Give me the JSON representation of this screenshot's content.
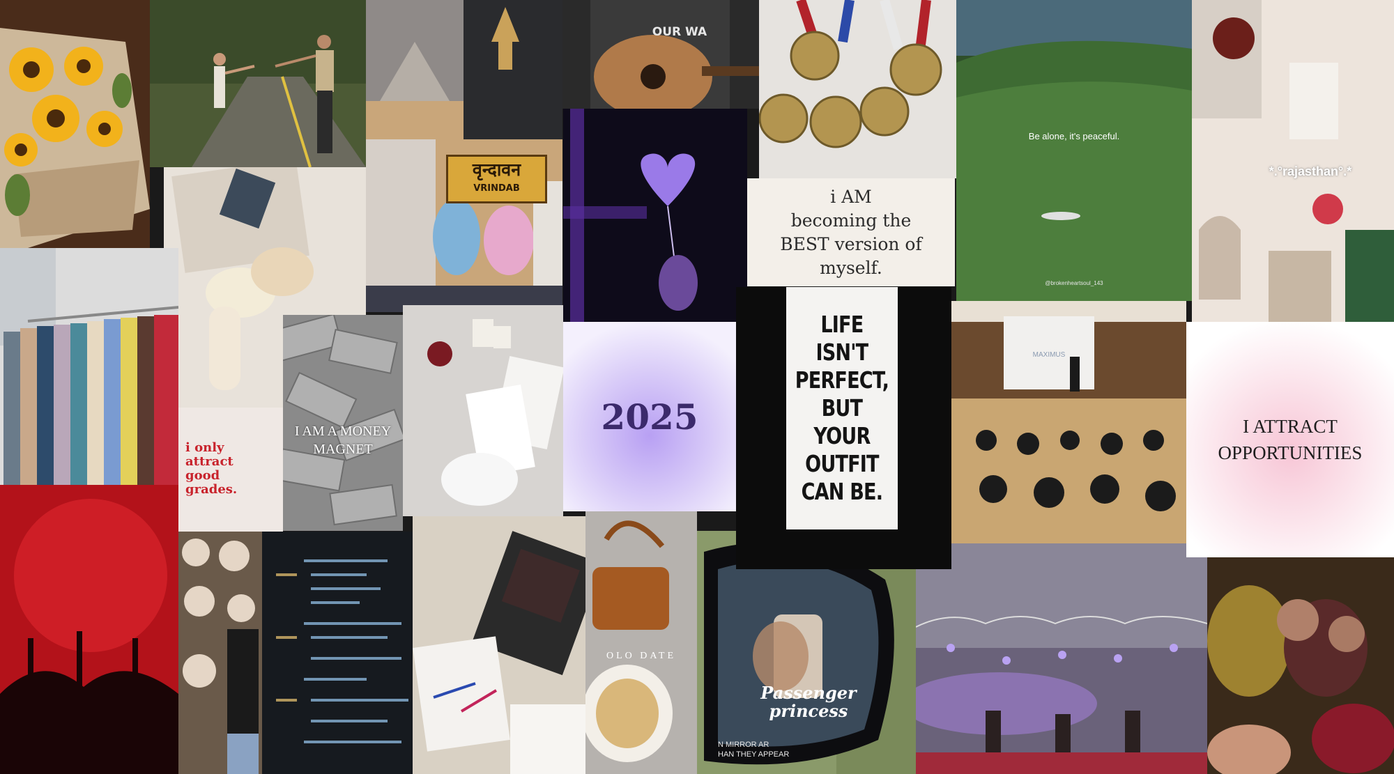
{
  "collage": {
    "becoming_text": "i AM\nbecoming the\nBEST version of\nmyself.",
    "year_text": "2025",
    "attract_text": "I ATTRACT\nOPPORTUNITIES",
    "grades_text": "i only\nattract\ngood\ngrades.",
    "outfit_text": "LIFE\nISN'T\nPERFECT,\nBUT YOUR\nOUTFIT\nCAN BE.",
    "money_text": "I AM A MONEY\nMAGNET",
    "peaceful_text": "Be alone, it's peaceful.",
    "peaceful_handle": "@brokenheartsoul_143",
    "rajasthan_text": "*.°rajasthan°.*",
    "vrindavan_sign_hindi": "वृन्दावन",
    "vrindavan_sign_latin": "VRINDAB",
    "passenger_text": "Passenger\nprincess",
    "mirror_text": "N MIRROR AR\nHAN THEY APPEAR",
    "date_text": "OLO DATE",
    "tshirt_text": "OUR WA",
    "presentation_text": "MAXIMUS"
  },
  "colors": {
    "grades_red": "#c8232c",
    "year_purple": "#3b2a6b",
    "attract_pink": "#f7c6d6",
    "concert_red": "#b3121a"
  }
}
